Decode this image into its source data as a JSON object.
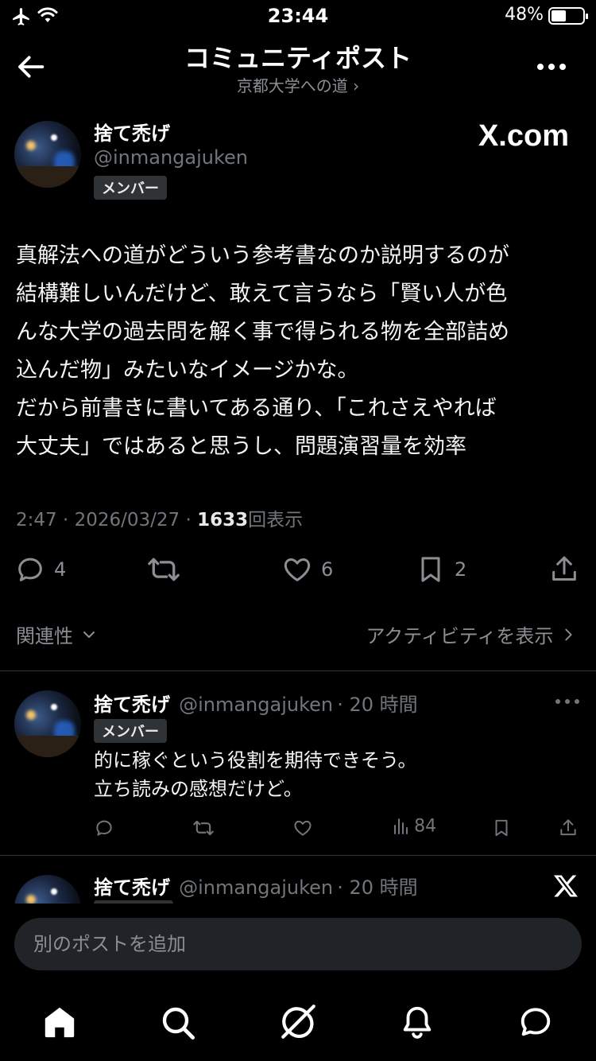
{
  "status_bar": {
    "time": "23:44",
    "battery_text": "48%",
    "battery_level": 0.48
  },
  "header": {
    "title": "コミュニティポスト",
    "subtitle": "京都大学への道 ›",
    "back_icon": "arrow-left-icon",
    "more_icon": "more-horizontal-icon"
  },
  "post": {
    "author_name": "捨て禿げ",
    "author_handle": "@inmangajuken",
    "badge": "メンバー",
    "watermark": "X.com",
    "text": "真解法への道がどういう参考書なのか説明するのが\n結構難しいんだけど、敢えて言うなら「賢い人が色\nんな大学の過去問を解く事で得られる物を全部詰め\n込んだ物」みたいなイメージかな。\nだから前書きに書いてある通り、「これさえやれば\n大丈夫」ではあると思うし、問題演習量を効率",
    "time_date": "2:47 · 2026/03/27 · ",
    "views_count": "1633",
    "views_label": "回表示",
    "actions": {
      "replies": "4",
      "likes": "6",
      "bookmarks": "2"
    }
  },
  "sort": {
    "label": "関連性",
    "activity_label": "アクティビティを表示"
  },
  "replies": [
    {
      "author_name": "捨て禿げ",
      "author_handle": "@inmangajuken",
      "time": "· 20 時間",
      "badge": "メンバー",
      "text": "的に稼ぐという役割を期待できそう。\n立ち読みの感想だけど。",
      "views": "84"
    },
    {
      "author_name": "捨て禿げ",
      "author_handle": "@inmangajuken",
      "time": "· 20 時間"
    }
  ],
  "composer": {
    "placeholder": "別のポストを追加"
  },
  "tabbar": {
    "items": [
      "home-icon",
      "search-icon",
      "grok-icon",
      "notifications-icon",
      "messages-icon"
    ]
  },
  "colors": {
    "background": "#000000",
    "text": "#e7e9ea",
    "muted": "#71767b",
    "divider": "#2f3336"
  }
}
